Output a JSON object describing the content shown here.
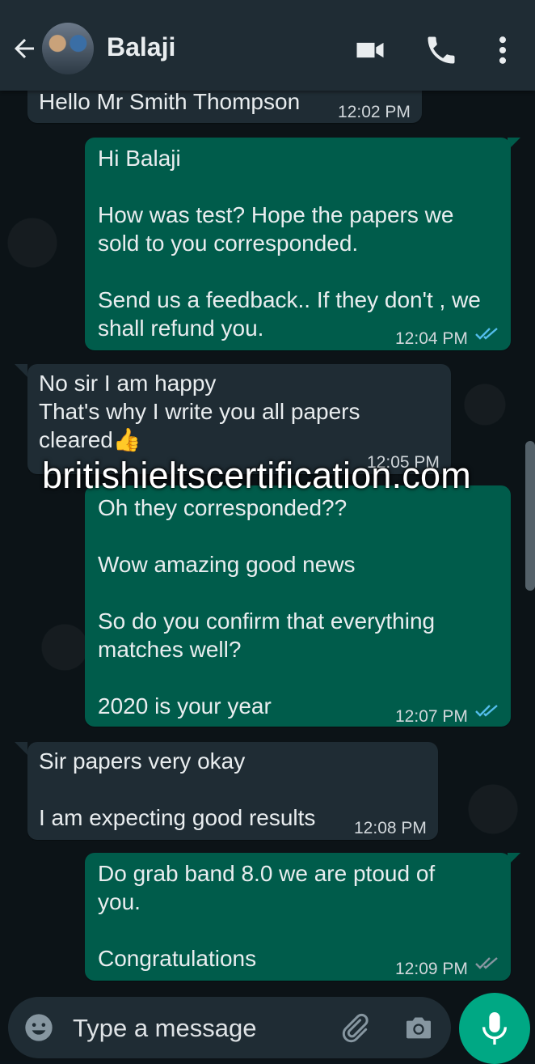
{
  "header": {
    "contact_name": "Balaji",
    "icons": [
      "back-arrow-icon",
      "avatar",
      "video-call-icon",
      "voice-call-icon",
      "more-options-icon"
    ]
  },
  "messages": [
    {
      "direction": "incoming",
      "text": "Hello Mr Smith Thompson",
      "time": "12:02 PM"
    },
    {
      "direction": "outgoing",
      "text": "Hi Balaji\n\nHow was test? Hope the papers we\nsold to you corresponded.\n\nSend us a feedback.. If they don't , we\nshall refund you.",
      "time": "12:04 PM",
      "ticks": "read"
    },
    {
      "direction": "incoming",
      "text": "No sir I am happy\nThat's why I write you all papers\ncleared👍",
      "time": "12:05 PM"
    },
    {
      "direction": "outgoing",
      "text": "Oh they corresponded??\n\nWow amazing good news\n\nSo do you confirm that everything\nmatches well?\n\n2020 is your year",
      "time": "12:07 PM",
      "ticks": "read"
    },
    {
      "direction": "incoming",
      "text": "Sir papers very okay\n\nI am expecting good results",
      "time": "12:08 PM"
    },
    {
      "direction": "outgoing",
      "text": "Do grab band 8.0 we are ptoud of\nyou.\n\nCongratulations",
      "time": "12:09 PM",
      "ticks": "delivered"
    }
  ],
  "watermark": "britishieltscertification.com",
  "composer": {
    "placeholder": "Type a message",
    "icons": [
      "emoji-icon",
      "attach-icon",
      "camera-icon",
      "mic-icon"
    ]
  },
  "colors": {
    "header_bg": "#1f2c34",
    "incoming_bubble": "#1f2c34",
    "outgoing_bubble": "#005c4b",
    "read_ticks": "#53bdeb",
    "delivered_ticks": "#8696a0",
    "mic_button": "#00a884"
  }
}
